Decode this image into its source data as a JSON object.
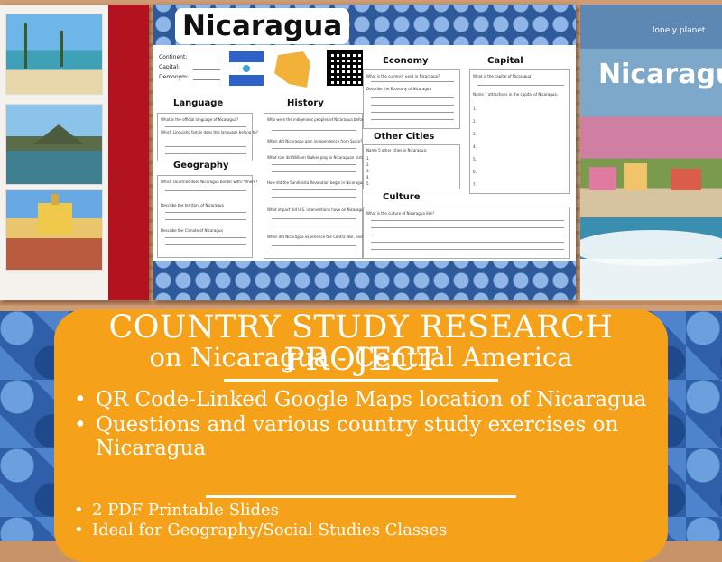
{
  "worksheet": {
    "title": "Nicaragua",
    "fields": [
      "Continent:",
      "Capital:",
      "Demonym:"
    ],
    "sections": {
      "language": {
        "title": "Language",
        "questions": [
          "What is the official language of Nicaragua?",
          "Which Linguistic family does this language belong to?"
        ]
      },
      "geography": {
        "title": "Geography",
        "questions": [
          "Which countries does Nicaragua border with? Where?",
          "Describe the territory of Nicaragua",
          "Describe the Climate of Nicaragua"
        ]
      },
      "history": {
        "title": "History",
        "questions": [
          "Who were the indigenous peoples of Nicaragua before Spanish colonization?",
          "When did Nicaragua gain independence from Spain?",
          "What role did William Walker play in Nicaraguan history?",
          "How did the Sandinista Revolution begin in Nicaragua?",
          "What impact did U.S. interventions have on Nicaraguan politics?",
          "When did Nicaragua experience the Contra War, and why?"
        ]
      },
      "economy": {
        "title": "Economy",
        "questions": [
          "What is the currency used in Nicaragua?",
          "Describe the Economy of Nicaragua"
        ]
      },
      "other_cities": {
        "title": "Other Cities",
        "questions": [
          "Name 5 other cities in Nicaragua:"
        ],
        "numbers": [
          "1.",
          "2.",
          "3.",
          "4.",
          "5."
        ]
      },
      "capital": {
        "title": "Capital",
        "questions": [
          "What is the capital of Nicaragua?",
          "Name 7 attractions in the capital of Nicaragua:"
        ],
        "numbers": [
          "1.",
          "2.",
          "3.",
          "4.",
          "5.",
          "6.",
          "7."
        ]
      },
      "culture": {
        "title": "Culture",
        "questions": [
          "What is the culture of Nicaragua like?"
        ]
      }
    }
  },
  "cover": {
    "brand": "lonely planet",
    "title": "Nicaragua"
  },
  "promo": {
    "headline_line1": "COUNTRY STUDY RESEARCH PROJECT",
    "headline_line2": "on Nicaragua - Central America",
    "bullets": [
      "QR Code-Linked Google Maps location of Nicaragua",
      "Questions and various country study exercises on Nicaragua"
    ],
    "small_bullets": [
      "2 PDF Printable Slides",
      "Ideal for Geography/Social Studies Classes"
    ]
  },
  "colors": {
    "orange_panel": "#f5a21a",
    "pattern_blue": "#2f5fa8",
    "red_panel": "#b3121f"
  }
}
